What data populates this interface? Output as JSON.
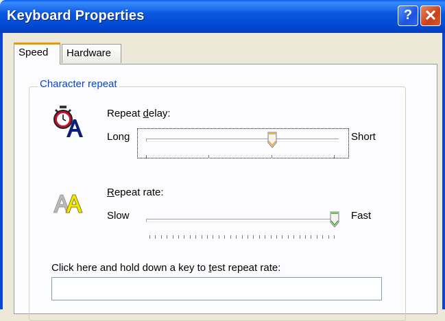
{
  "window": {
    "title": "Keyboard Properties",
    "help_glyph": "?",
    "close_glyph": "✕"
  },
  "tabs": [
    {
      "label": "Speed",
      "active": true
    },
    {
      "label": "Hardware",
      "active": false
    }
  ],
  "group": {
    "title": "Character repeat"
  },
  "repeat_delay": {
    "label_prefix": "Repeat ",
    "label_mnemonic": "d",
    "label_suffix": "elay:",
    "min_label": "Long",
    "max_label": "Short",
    "value_fraction": 0.67,
    "tick_count": 4
  },
  "repeat_rate": {
    "label_mnemonic": "R",
    "label_suffix": "epeat rate:",
    "min_label": "Slow",
    "max_label": "Fast",
    "value_fraction": 1.0,
    "tick_count": 33
  },
  "test": {
    "label_prefix": "Click here and hold down a key to ",
    "label_mnemonic": "t",
    "label_suffix": "est repeat rate:",
    "value": ""
  },
  "colors": {
    "title_blue": "#0046cf",
    "group_label": "#0046d5",
    "tab_accent": "#e69b00"
  }
}
